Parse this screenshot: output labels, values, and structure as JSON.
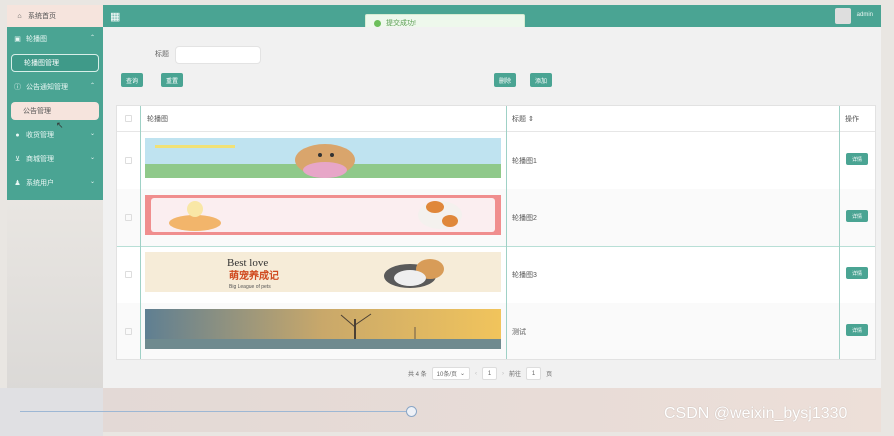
{
  "sidebar": {
    "home": "系统首页",
    "carousel": "轮播图",
    "carousel_manage": "轮播图管理",
    "notice": "公告通知管理",
    "notice_manage": "公告管理",
    "vip": "收货管理",
    "store": "商城管理",
    "users": "系统用户"
  },
  "header": {
    "title": "...",
    "toast": "提交成功!",
    "user": "admin"
  },
  "search": {
    "label": "标题",
    "query_btn": "查询",
    "reset_btn": "重置",
    "delete_btn": "删除",
    "add_btn": "添加"
  },
  "table": {
    "headers": [
      "轮播图",
      "标题 ⇕",
      "操作"
    ],
    "rows": [
      {
        "title": "轮播图1",
        "action": "详情"
      },
      {
        "title": "轮播图2",
        "action": "详情"
      },
      {
        "title": "轮播图3",
        "action": "详情"
      },
      {
        "title": "测试",
        "action": "详情"
      }
    ],
    "banner_text": {
      "line1": "Best love",
      "line2": "萌宠养成记",
      "line3": "Big League of pets"
    }
  },
  "pager": {
    "total": "共 4 条",
    "page_size": "10条/页",
    "current": "1",
    "goto_label": "前往",
    "goto_value": "1",
    "page_suffix": "页"
  },
  "watermark": "CSDN @weixin_bysj1330",
  "colors": {
    "brand": "#4aa493",
    "accent_light": "#f6e4dd"
  }
}
